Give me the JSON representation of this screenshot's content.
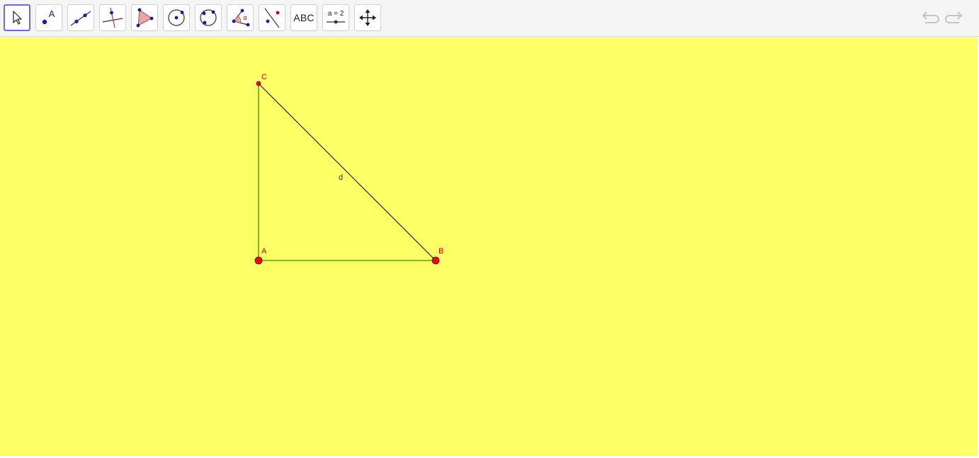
{
  "toolbar": {
    "tools": [
      {
        "id": "move",
        "icon": "cursor-arrow-icon",
        "selected": true
      },
      {
        "id": "point",
        "icon": "point-icon",
        "label": "A"
      },
      {
        "id": "line",
        "icon": "line-through-two-points-icon"
      },
      {
        "id": "perpendicular",
        "icon": "perpendicular-line-icon"
      },
      {
        "id": "polygon",
        "icon": "polygon-icon"
      },
      {
        "id": "circle",
        "icon": "circle-center-point-icon"
      },
      {
        "id": "circle-three-points",
        "icon": "circle-through-three-points-icon"
      },
      {
        "id": "angle",
        "icon": "angle-icon",
        "label": "α"
      },
      {
        "id": "reflect",
        "icon": "reflect-about-line-icon"
      },
      {
        "id": "text",
        "icon": "text-icon",
        "label": "ABC"
      },
      {
        "id": "slider",
        "icon": "slider-icon",
        "label": "a = 2"
      },
      {
        "id": "move-graphics",
        "icon": "move-graphics-view-icon"
      }
    ],
    "undo_icon": "undo-icon",
    "redo_icon": "redo-icon"
  },
  "colors": {
    "canvas_background": "#ffff66",
    "point": "#ff0000",
    "label": "#cc0000",
    "segment": "#339900",
    "hypotenuse": "#000000",
    "tool_blue": "#1a1aa6",
    "selected_border": "#6a6ad8"
  },
  "construction": {
    "points": [
      {
        "name": "A",
        "label": "A"
      },
      {
        "name": "B",
        "label": "B"
      },
      {
        "name": "C",
        "label": "C"
      }
    ],
    "segments": [
      {
        "name": "AB",
        "from": "A",
        "to": "B"
      },
      {
        "name": "AC",
        "from": "A",
        "to": "C"
      }
    ],
    "hypotenuse": {
      "name": "d",
      "label": "d",
      "from": "C",
      "to": "B"
    }
  }
}
